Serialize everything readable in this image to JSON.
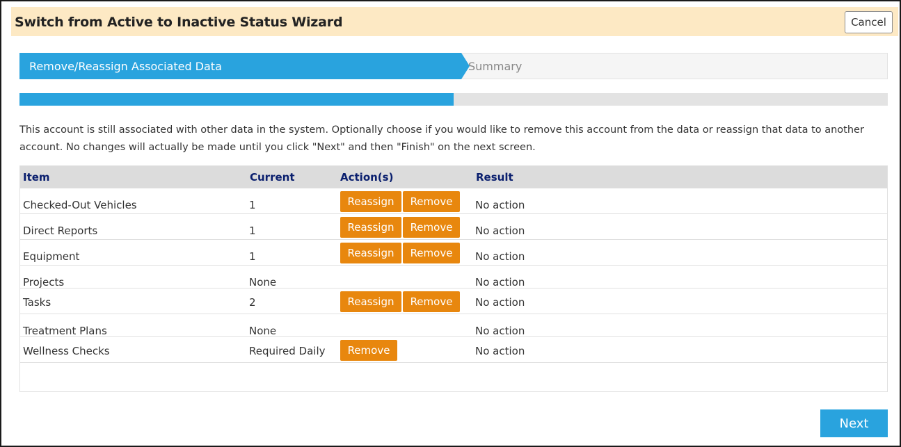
{
  "window": {
    "title": "Switch from Active to Inactive Status Wizard",
    "cancel_label": "Cancel"
  },
  "steps": [
    {
      "label": "Remove/Reassign Associated Data",
      "active": true
    },
    {
      "label": "Summary",
      "active": false
    }
  ],
  "progress": {
    "fraction": 0.5
  },
  "intro_text": "This account is still associated with other data in the system. Optionally choose if you would like to remove this account from the data or reassign that data to another account. No changes will actually be made until you click \"Next\" and then \"Finish\" on the next screen.",
  "table": {
    "headers": {
      "item": "Item",
      "current": "Current",
      "actions": "Action(s)",
      "result": "Result"
    },
    "rows": [
      {
        "item": "Checked-Out Vehicles",
        "current": "1",
        "actions": [
          "Reassign",
          "Remove"
        ],
        "result": "No action"
      },
      {
        "item": "Direct Reports",
        "current": "1",
        "actions": [
          "Reassign",
          "Remove"
        ],
        "result": "No action"
      },
      {
        "item": "Equipment",
        "current": "1",
        "actions": [
          "Reassign",
          "Remove"
        ],
        "result": "No action"
      },
      {
        "item": "Projects",
        "current": "None",
        "actions": [],
        "result": "No action"
      },
      {
        "item": "Tasks",
        "current": "2",
        "actions": [
          "Reassign",
          "Remove"
        ],
        "result": "No action"
      },
      {
        "item": "Treatment Plans",
        "current": "None",
        "actions": [],
        "result": "No action"
      },
      {
        "item": "Wellness Checks",
        "current": "Required Daily",
        "actions": [
          "Remove"
        ],
        "result": "No action"
      }
    ]
  },
  "footer": {
    "next_label": "Next"
  },
  "colors": {
    "accent_blue": "#29a3de",
    "action_orange": "#e8870e",
    "title_bar": "#fde9c4",
    "header_text": "#0a1f6e"
  }
}
